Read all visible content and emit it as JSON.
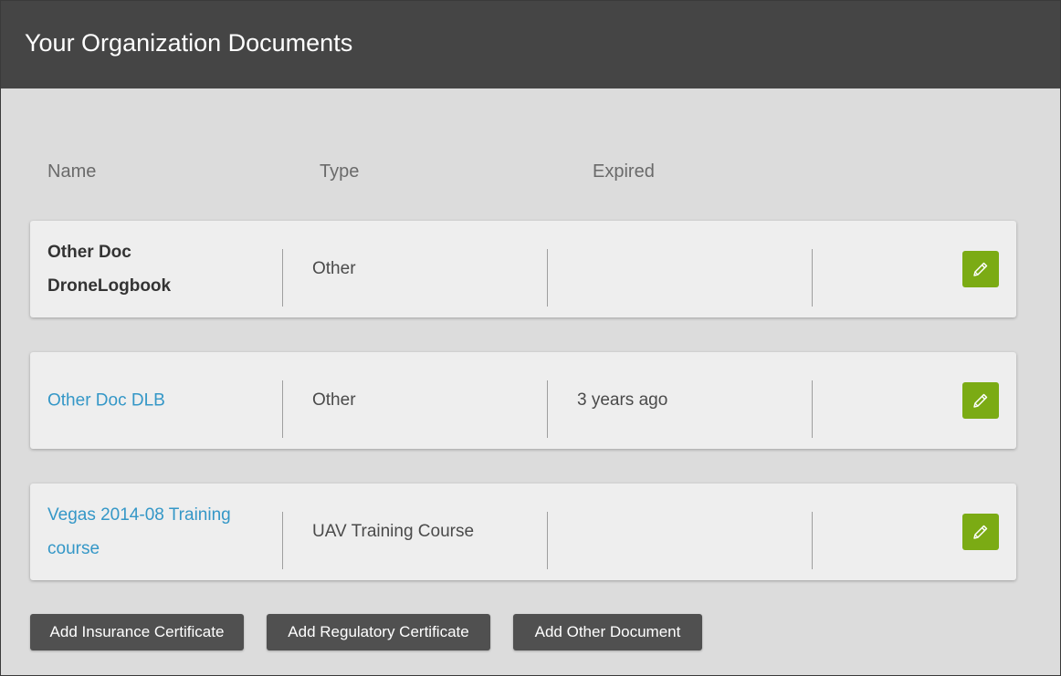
{
  "header": {
    "title": "Your Organization Documents"
  },
  "columns": {
    "name": "Name",
    "type": "Type",
    "expired": "Expired"
  },
  "documents": [
    {
      "name_line1": "Other Doc",
      "name_line2": "DroneLogbook",
      "type": "Other",
      "expired": "",
      "name_style": "bold"
    },
    {
      "name_line1": "Other Doc DLB",
      "name_line2": "",
      "type": "Other",
      "expired": "3 years ago",
      "name_style": "link"
    },
    {
      "name_line1": "Vegas 2014-08 Training",
      "name_line2": "course",
      "type": "UAV Training Course",
      "expired": "",
      "name_style": "link"
    }
  ],
  "actions": {
    "add_insurance": "Add Insurance Certificate",
    "add_regulatory": "Add Regulatory Certificate",
    "add_other": "Add Other Document"
  },
  "icons": {
    "edit": "pencil-icon"
  },
  "colors": {
    "header_bg": "#454545",
    "page_bg": "#dcdcdc",
    "card_bg": "#eeeeee",
    "link": "#3497c7",
    "edit_button": "#7bab14",
    "action_button": "#505050"
  }
}
